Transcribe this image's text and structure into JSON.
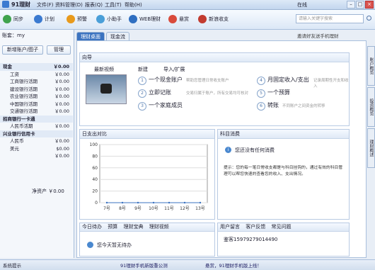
{
  "app": {
    "title": "91理财",
    "user_label": "在线"
  },
  "menu": [
    "文件(F)",
    "资料管理(D)",
    "报表(Q)",
    "工具(T)",
    "帮助(H)"
  ],
  "toolbar": {
    "buttons": [
      {
        "label": "同步",
        "color": "#3fa34d"
      },
      {
        "label": "计划",
        "color": "#3b7ad0"
      },
      {
        "label": "预警",
        "color": "#e89a1c"
      },
      {
        "label": "小助手",
        "color": "#4a9fd8"
      },
      {
        "label": "WEB理财",
        "color": "#2f6fc1"
      },
      {
        "label": "悬赏",
        "color": "#d94b3c"
      },
      {
        "label": "新浪收支",
        "color": "#c23b2f"
      }
    ],
    "search_placeholder": "请输入关键字搜索"
  },
  "promo": "邀请好友送手机理财",
  "account": {
    "title": "账套：my",
    "add_button": "新增账户/图子",
    "manage_button": "管理",
    "items": [
      {
        "name": "现金",
        "value": "￥0.00",
        "cat": true
      },
      {
        "name": "工资",
        "value": "￥0.00"
      },
      {
        "name": "工商银行活期",
        "value": "￥0.00"
      },
      {
        "name": "建设银行活期",
        "value": "￥0.00"
      },
      {
        "name": "农业银行活期",
        "value": "￥0.00"
      },
      {
        "name": "中国银行活期",
        "value": "￥0.00"
      },
      {
        "name": "交通银行活期",
        "value": "￥0.00"
      },
      {
        "name": "招商银行一卡通",
        "value": "",
        "cat": true
      },
      {
        "name": "人民币活期",
        "value": "￥0.00"
      },
      {
        "name": "兴业银行信用卡",
        "value": "",
        "cat": true
      },
      {
        "name": "人民币",
        "value": "￥0.00"
      },
      {
        "name": "美元",
        "value": "$0.00"
      },
      {
        "name": "",
        "value": "￥0.00"
      }
    ],
    "net_asset_label": "净资产",
    "net_asset_value": "￥0.00"
  },
  "tabs": [
    "理财桌面",
    "现金流"
  ],
  "guide": {
    "title": "向导",
    "recent_video": "最新视频",
    "new_button": "新建",
    "import_button": "导入/扩展",
    "items": [
      {
        "num": "1",
        "label": "一个现金账户",
        "hint": "帮助您管理日常收支账户"
      },
      {
        "num": "2",
        "label": "立即记账",
        "hint": "交易归属于账户，所有交易均可核对"
      },
      {
        "num": "3",
        "label": "一个家庭成员",
        "hint": ""
      },
      {
        "num": "4",
        "label": "月固定收入/支出",
        "hint": "记录周期性开支和收入"
      },
      {
        "num": "5",
        "label": "一个预算",
        "hint": ""
      },
      {
        "num": "6",
        "label": "转账",
        "hint": "不同账户之间资金的转移"
      }
    ]
  },
  "chart_panel": {
    "title": "日支出对比"
  },
  "chart_data": {
    "type": "line",
    "categories": [
      "7号",
      "8号",
      "9号",
      "10号",
      "11号",
      "12号",
      "13号"
    ],
    "values": [
      0,
      0,
      0,
      0,
      0,
      0,
      0
    ],
    "ylabels": [
      "100",
      "80",
      "60",
      "40",
      "20",
      "0"
    ],
    "ylim": [
      0,
      100
    ]
  },
  "consume_panel": {
    "title": "科目消费",
    "empty_msg": "您还没有任何消费",
    "tip": "提示：您的每一笔日常收支都是与科目挂钩的，通过有效的科目管理可以帮您快速的查看您的收入、支出情况。"
  },
  "bottom_left": {
    "tabs": [
      "今日待办",
      "预算",
      "理财宝典",
      "理财视频"
    ],
    "msg": "您今天暂无待办"
  },
  "bottom_right": {
    "tabs": [
      "用户留言",
      "客户反馈",
      "常见问题"
    ],
    "line1": "鉴客15979279014490"
  },
  "side_tabs": [
    "账户概览",
    "投资概览",
    "理财概述"
  ],
  "status": {
    "label": "系统提示",
    "center": "91理财手机新版重公测",
    "right": "悬赏，91理财手机版上线！"
  }
}
